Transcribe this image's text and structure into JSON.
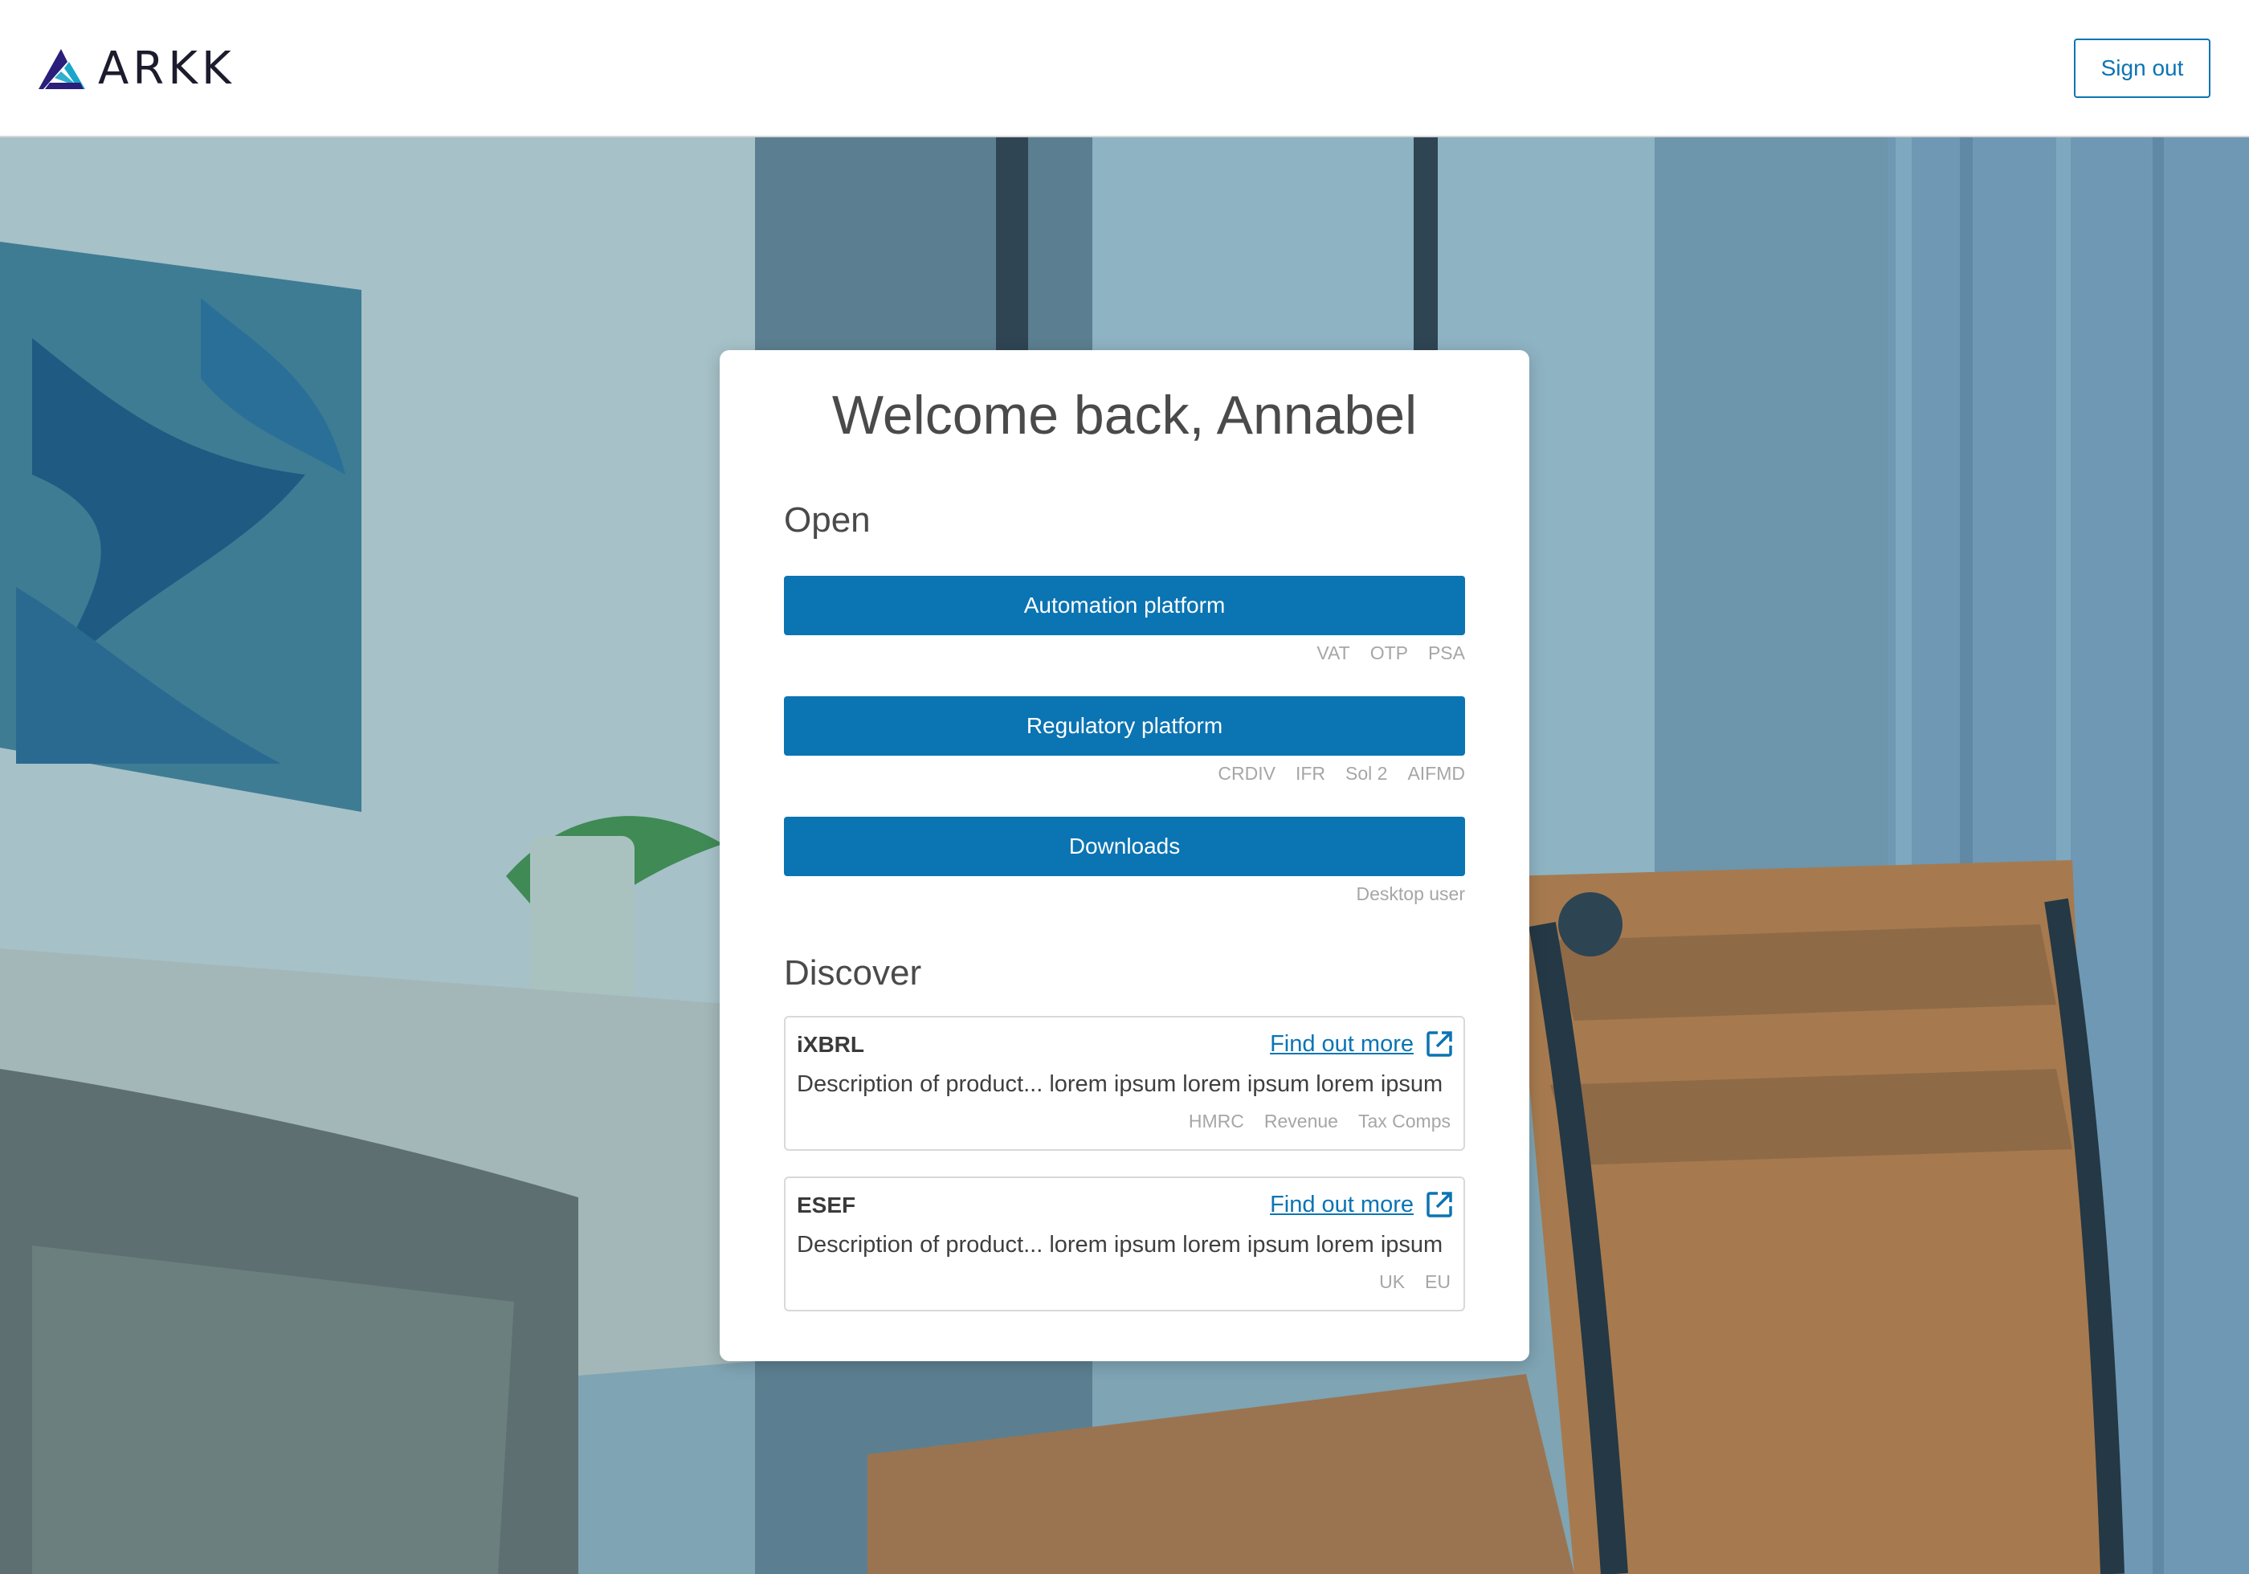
{
  "header": {
    "logo_text": "ARKK",
    "signout_label": "Sign out"
  },
  "card": {
    "welcome": "Welcome back, Annabel",
    "open_title": "Open",
    "buttons": [
      {
        "label": "Automation platform",
        "tags": [
          "VAT",
          "OTP",
          "PSA"
        ]
      },
      {
        "label": "Regulatory platform",
        "tags": [
          "CRDIV",
          "IFR",
          "Sol 2",
          "AIFMD"
        ]
      },
      {
        "label": "Downloads",
        "tags": [
          "Desktop user"
        ]
      }
    ],
    "discover_title": "Discover",
    "products": [
      {
        "name": "iXBRL",
        "link": "Find out more",
        "description": "Description of product... lorem ipsum lorem ipsum lorem ipsum",
        "tags": [
          "HMRC",
          "Revenue",
          "Tax Comps"
        ]
      },
      {
        "name": "ESEF",
        "link": "Find out more",
        "description": "Description of product... lorem ipsum lorem ipsum lorem ipsum",
        "tags": [
          "UK",
          "EU"
        ]
      }
    ]
  },
  "colors": {
    "brand_blue": "#0b74b3",
    "logo_navy": "#2a1f7a",
    "logo_teal": "#1aa6c9"
  }
}
